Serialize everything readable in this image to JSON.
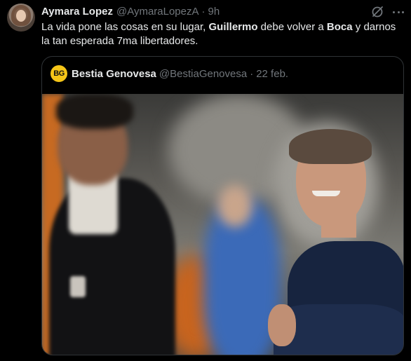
{
  "tweet": {
    "author_name": "Aymara Lopez",
    "author_handle": "@AymaraLopezA",
    "separator": "·",
    "time": "9h",
    "text_parts": [
      "La vida pone las cosas en su lugar, ",
      "Guillermo",
      " debe volver a ",
      "Boca",
      " y darnos la tan esperada 7ma libertadores."
    ]
  },
  "quote": {
    "avatar_initials": "BG",
    "author_name": "Bestia Genovesa",
    "author_handle": "@BestiaGenovesa",
    "separator": "·",
    "date": "22 feb."
  },
  "icons": {
    "grok": "grok-icon",
    "more": "more-options-icon"
  },
  "colors": {
    "background": "#000000",
    "text_primary": "#e7e9ea",
    "text_secondary": "#71767b",
    "border": "#2f3336",
    "quote_avatar": "#f5c518"
  }
}
